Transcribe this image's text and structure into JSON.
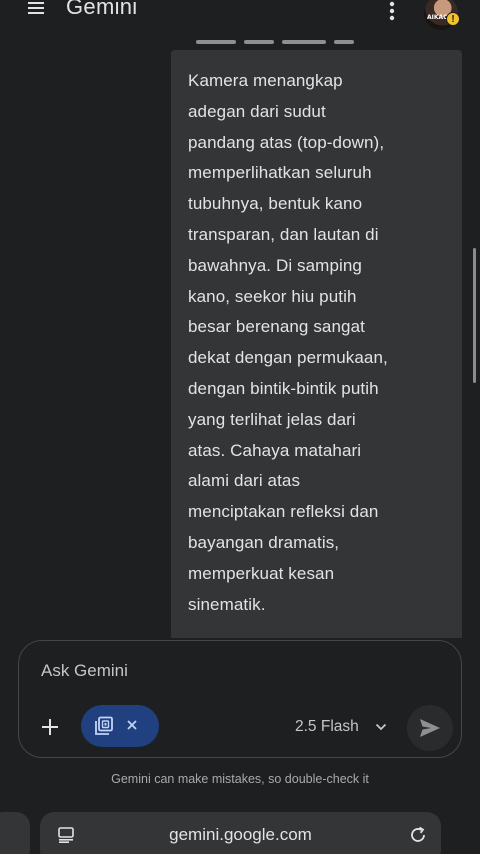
{
  "header": {
    "title": "Gemini",
    "menu_icon": "hamburger-menu-icon",
    "more_icon": "more-vert-icon",
    "avatar_text": "AIKAC",
    "avatar_badge": "!"
  },
  "message": {
    "text": "Kamera menangkap\nadegan dari sudut\npandang atas (top-down),\nmemperlihatkan seluruh\ntubuhnya, bentuk kano\ntransparan, dan lautan di\nbawahnya. Di samping\nkano, seekor hiu putih\nbesar berenang sangat\ndekat dengan permukaan,\ndengan bintik-bintik putih\nyang terlihat jelas dari\natas. Cahaya matahari\nalami dari atas\nmenciptakan refleksi dan\nbayangan dramatis,\nmemperkuat kesan\nsinematik."
  },
  "input": {
    "placeholder": "Ask Gemini",
    "add_icon": "plus-icon",
    "attachment_icon": "image-attachment-icon",
    "remove_icon": "close-icon",
    "model": "2.5 Flash",
    "send_icon": "send-icon"
  },
  "disclaimer": "Gemini can make mistakes, so double-check it",
  "browser": {
    "url": "gemini.google.com",
    "page_icon": "page-info-icon",
    "reload_icon": "reload-icon"
  },
  "colors": {
    "background": "#1e1f20",
    "bubble": "#333537",
    "chip": "#204080",
    "text": "#e3e3e3",
    "muted": "#a8abaa",
    "badge": "#f2c230"
  }
}
